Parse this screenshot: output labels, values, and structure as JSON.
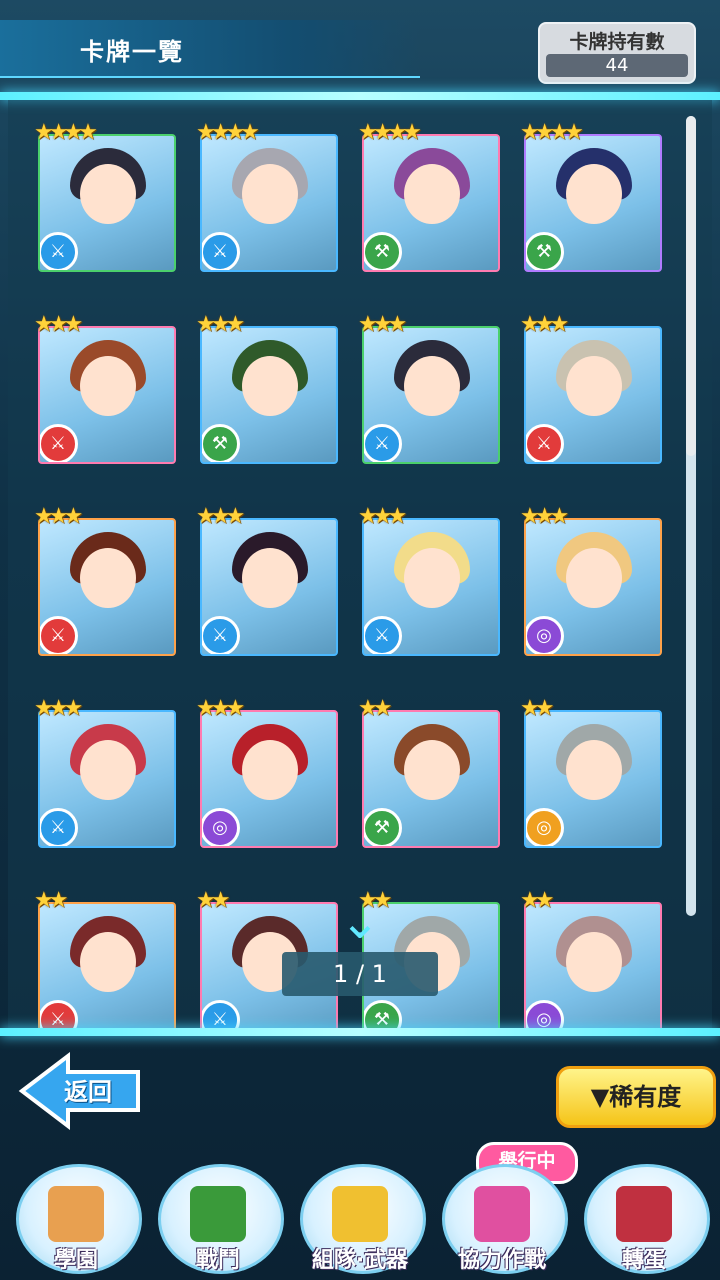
{
  "header": {
    "title": "卡牌一覽"
  },
  "holding": {
    "label": "卡牌持有數",
    "value": "44"
  },
  "cards": [
    {
      "stars": "★★★★",
      "frame": "green",
      "hair": "#2b2b3b",
      "weapon": "w-blue",
      "glyph": "⚔"
    },
    {
      "stars": "★★★★",
      "frame": "blue",
      "hair": "#a7a7b0",
      "weapon": "w-blue",
      "glyph": "⚔"
    },
    {
      "stars": "★★★★",
      "frame": "pink",
      "hair": "#8a4a9a",
      "weapon": "w-green",
      "glyph": "⚒"
    },
    {
      "stars": "★★★★",
      "frame": "purple",
      "hair": "#25306b",
      "weapon": "w-green",
      "glyph": "⚒"
    },
    {
      "stars": "★★★",
      "frame": "pink",
      "hair": "#9a4a2a",
      "weapon": "w-red",
      "glyph": "⚔"
    },
    {
      "stars": "★★★",
      "frame": "blue",
      "hair": "#2f5a2a",
      "weapon": "w-green",
      "glyph": "⚒"
    },
    {
      "stars": "★★★",
      "frame": "green",
      "hair": "#2b2b3b",
      "weapon": "w-blue",
      "glyph": "⚔"
    },
    {
      "stars": "★★★",
      "frame": "blue",
      "hair": "#c9c2b0",
      "weapon": "w-red",
      "glyph": "⚔"
    },
    {
      "stars": "★★★",
      "frame": "orange",
      "hair": "#6a2a1a",
      "weapon": "w-red",
      "glyph": "⚔"
    },
    {
      "stars": "★★★",
      "frame": "blue",
      "hair": "#2a1a2a",
      "weapon": "w-blue",
      "glyph": "⚔"
    },
    {
      "stars": "★★★",
      "frame": "blue",
      "hair": "#f2dc8a",
      "weapon": "w-blue",
      "glyph": "⚔"
    },
    {
      "stars": "★★★",
      "frame": "orange",
      "hair": "#f0c880",
      "weapon": "w-purple",
      "glyph": "◎"
    },
    {
      "stars": "★★★",
      "frame": "blue",
      "hair": "#c83a4a",
      "weapon": "w-blue",
      "glyph": "⚔"
    },
    {
      "stars": "★★★",
      "frame": "pink",
      "hair": "#b8202a",
      "weapon": "w-purple",
      "glyph": "◎"
    },
    {
      "stars": "★★",
      "frame": "pink",
      "hair": "#8a4a2a",
      "weapon": "w-green",
      "glyph": "⚒"
    },
    {
      "stars": "★★",
      "frame": "blue",
      "hair": "#a0a8a8",
      "weapon": "w-orange",
      "glyph": "◎"
    },
    {
      "stars": "★★",
      "frame": "orange",
      "hair": "#7a2a2a",
      "weapon": "w-red",
      "glyph": "⚔"
    },
    {
      "stars": "★★",
      "frame": "pink",
      "hair": "#5a2a2a",
      "weapon": "w-blue",
      "glyph": "⚔"
    },
    {
      "stars": "★★",
      "frame": "green",
      "hair": "#a0a8a8",
      "weapon": "w-green",
      "glyph": "⚒"
    },
    {
      "stars": "★★",
      "frame": "pink",
      "hair": "#b09090",
      "weapon": "w-purple",
      "glyph": "◎"
    }
  ],
  "pager": {
    "text": "1 / 1"
  },
  "back": {
    "label": "返回"
  },
  "rarity": {
    "label": "▼稀有度"
  },
  "event_badge": "舉行中",
  "nav": [
    {
      "label": "學園",
      "icon": "school-icon",
      "color": "#e8a050"
    },
    {
      "label": "戰鬥",
      "icon": "battle-icon",
      "color": "#3a9a3a"
    },
    {
      "label": "組隊·武器",
      "icon": "team-weapon-icon",
      "color": "#f0c030"
    },
    {
      "label": "協力作戰",
      "icon": "coop-icon",
      "color": "#e050a0"
    },
    {
      "label": "轉蛋",
      "icon": "gacha-icon",
      "color": "#c03040"
    }
  ]
}
